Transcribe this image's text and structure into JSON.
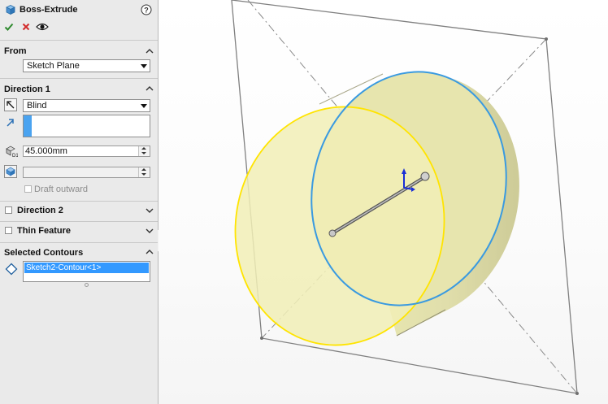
{
  "feature": {
    "title": "Boss-Extrude",
    "icon": "boss-extrude-icon",
    "help_icon": "help-icon"
  },
  "actions": {
    "ok_icon": "check-icon",
    "cancel_icon": "close-icon",
    "preview_icon": "eye-icon"
  },
  "from": {
    "title": "From",
    "value": "Sketch Plane"
  },
  "direction1": {
    "title": "Direction 1",
    "end_condition": "Blind",
    "depth": "45.000mm",
    "draft_label": "Draft outward"
  },
  "direction2": {
    "title": "Direction 2"
  },
  "thin_feature": {
    "title": "Thin Feature"
  },
  "selected_contours": {
    "title": "Selected Contours",
    "items": [
      "Sketch2-Contour<1>"
    ]
  },
  "colors": {
    "ok": "#2f8a2f",
    "cancel": "#d22c2c",
    "selection": "#3399ff",
    "preview_face": "#f1efb6",
    "front_edge": "#ffe400",
    "back_edge": "#3a9ae0"
  }
}
